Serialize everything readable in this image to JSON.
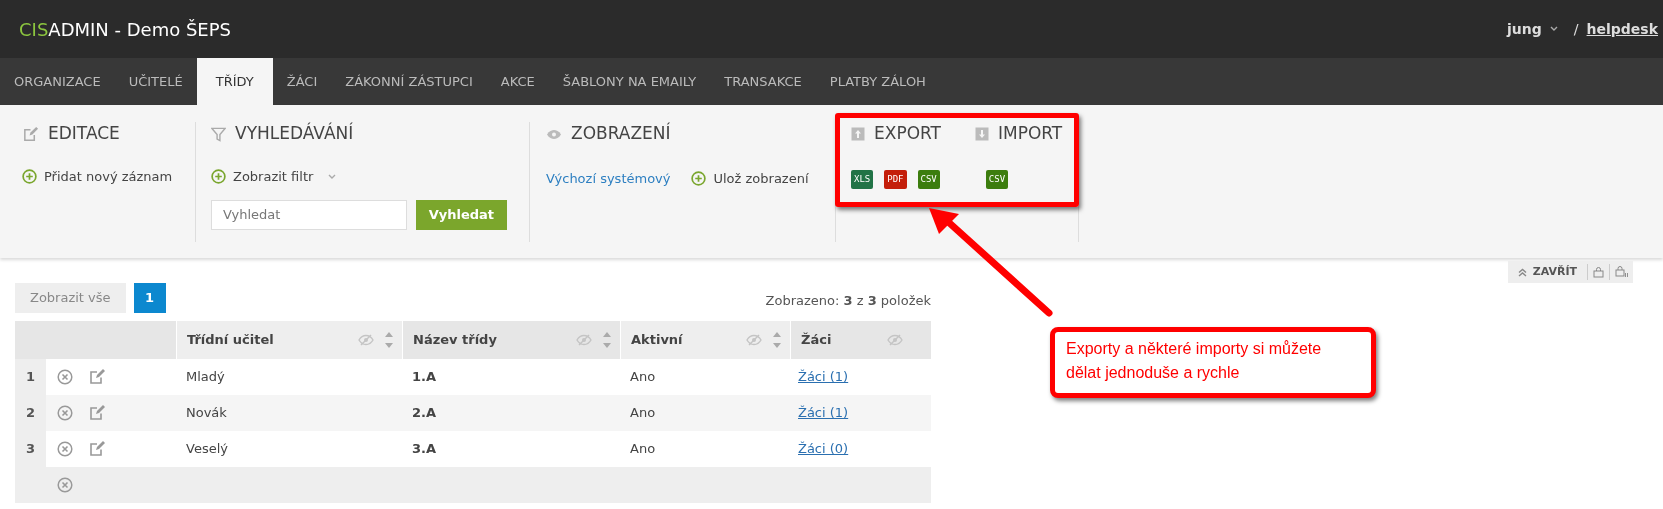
{
  "header": {
    "brand_prefix": "CIS",
    "brand": "ADMIN - Demo ŠEPS",
    "user": "jung",
    "separator": "/",
    "helpdesk": "helpdesk"
  },
  "tabs": [
    {
      "label": "ORGANIZACE",
      "selected": false
    },
    {
      "label": "UČITELÉ",
      "selected": false
    },
    {
      "label": "TŘÍDY",
      "selected": true
    },
    {
      "label": "ŽÁCI",
      "selected": false
    },
    {
      "label": "ZÁKONNÍ ZÁSTUPCI",
      "selected": false
    },
    {
      "label": "AKCE",
      "selected": false
    },
    {
      "label": "ŠABLONY NA EMAILY",
      "selected": false
    },
    {
      "label": "TRANSAKCE",
      "selected": false
    },
    {
      "label": "PLATBY ZÁLOH",
      "selected": false
    }
  ],
  "toolbar": {
    "editace": {
      "title": "EDITACE",
      "action": "Přidat nový záznam"
    },
    "vyhledavani": {
      "title": "VYHLEDÁVÁNÍ",
      "filter": "Zobrazit filtr",
      "placeholder": "Vyhledat",
      "button": "Vyhledat"
    },
    "zobrazeni": {
      "title": "ZOBRAZENÍ",
      "default_link": "Výchozí systémový",
      "save": "Ulož zobrazení"
    },
    "export": {
      "title": "EXPORT",
      "formats": [
        {
          "label": "XLS",
          "color": "#217346"
        },
        {
          "label": "PDF",
          "color": "#c41e0a"
        },
        {
          "label": "CSV",
          "color": "#3c7d0e"
        }
      ]
    },
    "import": {
      "title": "IMPORT",
      "formats": [
        {
          "label": "CSV",
          "color": "#3c7d0e"
        }
      ]
    }
  },
  "close_bar": {
    "label": "ZAVŘÍT"
  },
  "pager": {
    "show_all": "Zobrazit vše",
    "pages": [
      {
        "label": "1",
        "selected": true
      }
    ]
  },
  "count": {
    "prefix": "Zobrazeno:",
    "shown": "3",
    "middle": "z",
    "total": "3",
    "suffix": "položek"
  },
  "table": {
    "columns": [
      {
        "label": "Třídní učitel",
        "sortable": true
      },
      {
        "label": "Název třídy",
        "sortable": true
      },
      {
        "label": "Aktivní",
        "sortable": true
      },
      {
        "label": "Žáci",
        "sortable": false
      }
    ],
    "rows": [
      {
        "kind": "record",
        "number": "1",
        "teacher": "Mladý",
        "class": "1.A",
        "active": "Ano",
        "pupils": "Žáci (1)"
      },
      {
        "kind": "record",
        "number": "2",
        "teacher": "Novák",
        "class": "2.A",
        "active": "Ano",
        "pupils": "Žáci (1)"
      },
      {
        "kind": "record",
        "number": "3",
        "teacher": "Veselý",
        "class": "3.A",
        "active": "Ano",
        "pupils": "Žáci (0)"
      },
      {
        "kind": "new"
      }
    ]
  },
  "callout": {
    "text": "Exporty a některé importy si můžete dělat jednoduše a rychle"
  }
}
